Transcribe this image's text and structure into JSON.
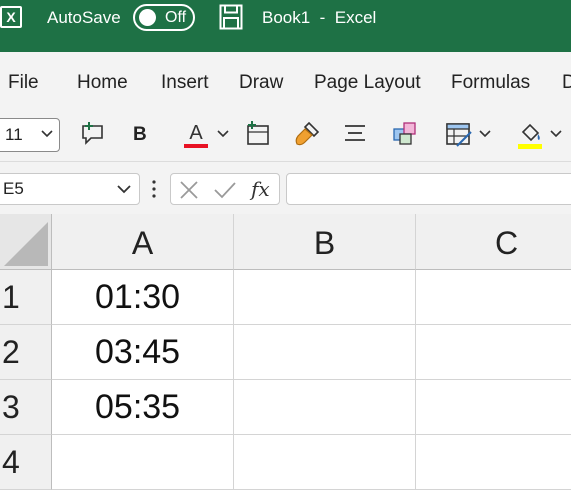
{
  "titlebar": {
    "autosave_label": "AutoSave",
    "autosave_state": "Off",
    "doc_title": "Book1  -  Excel",
    "app_color": "#1e7145"
  },
  "tabs": [
    "File",
    "Home",
    "Insert",
    "Draw",
    "Page Layout",
    "Formulas",
    "D"
  ],
  "toolbar": {
    "font_size": "11",
    "bold_label": "B",
    "font_color_label": "A",
    "font_color": "#e81123",
    "highlight_color": "#ffff00",
    "icons": [
      "new-comment-icon",
      "bold-icon",
      "font-color-icon",
      "insert-cells-icon",
      "format-painter-icon",
      "align-icon",
      "3d-shapes-icon",
      "format-table-icon",
      "fill-color-icon"
    ]
  },
  "formula_bar": {
    "name_box": "E5",
    "fx_label": "fx",
    "formula": ""
  },
  "sheet": {
    "columns": [
      "A",
      "B",
      "C"
    ],
    "rows": [
      "1",
      "2",
      "3",
      "4"
    ],
    "cells": [
      [
        "01:30",
        "",
        ""
      ],
      [
        "03:45",
        "",
        ""
      ],
      [
        "05:35",
        "",
        ""
      ],
      [
        "",
        "",
        ""
      ]
    ]
  }
}
